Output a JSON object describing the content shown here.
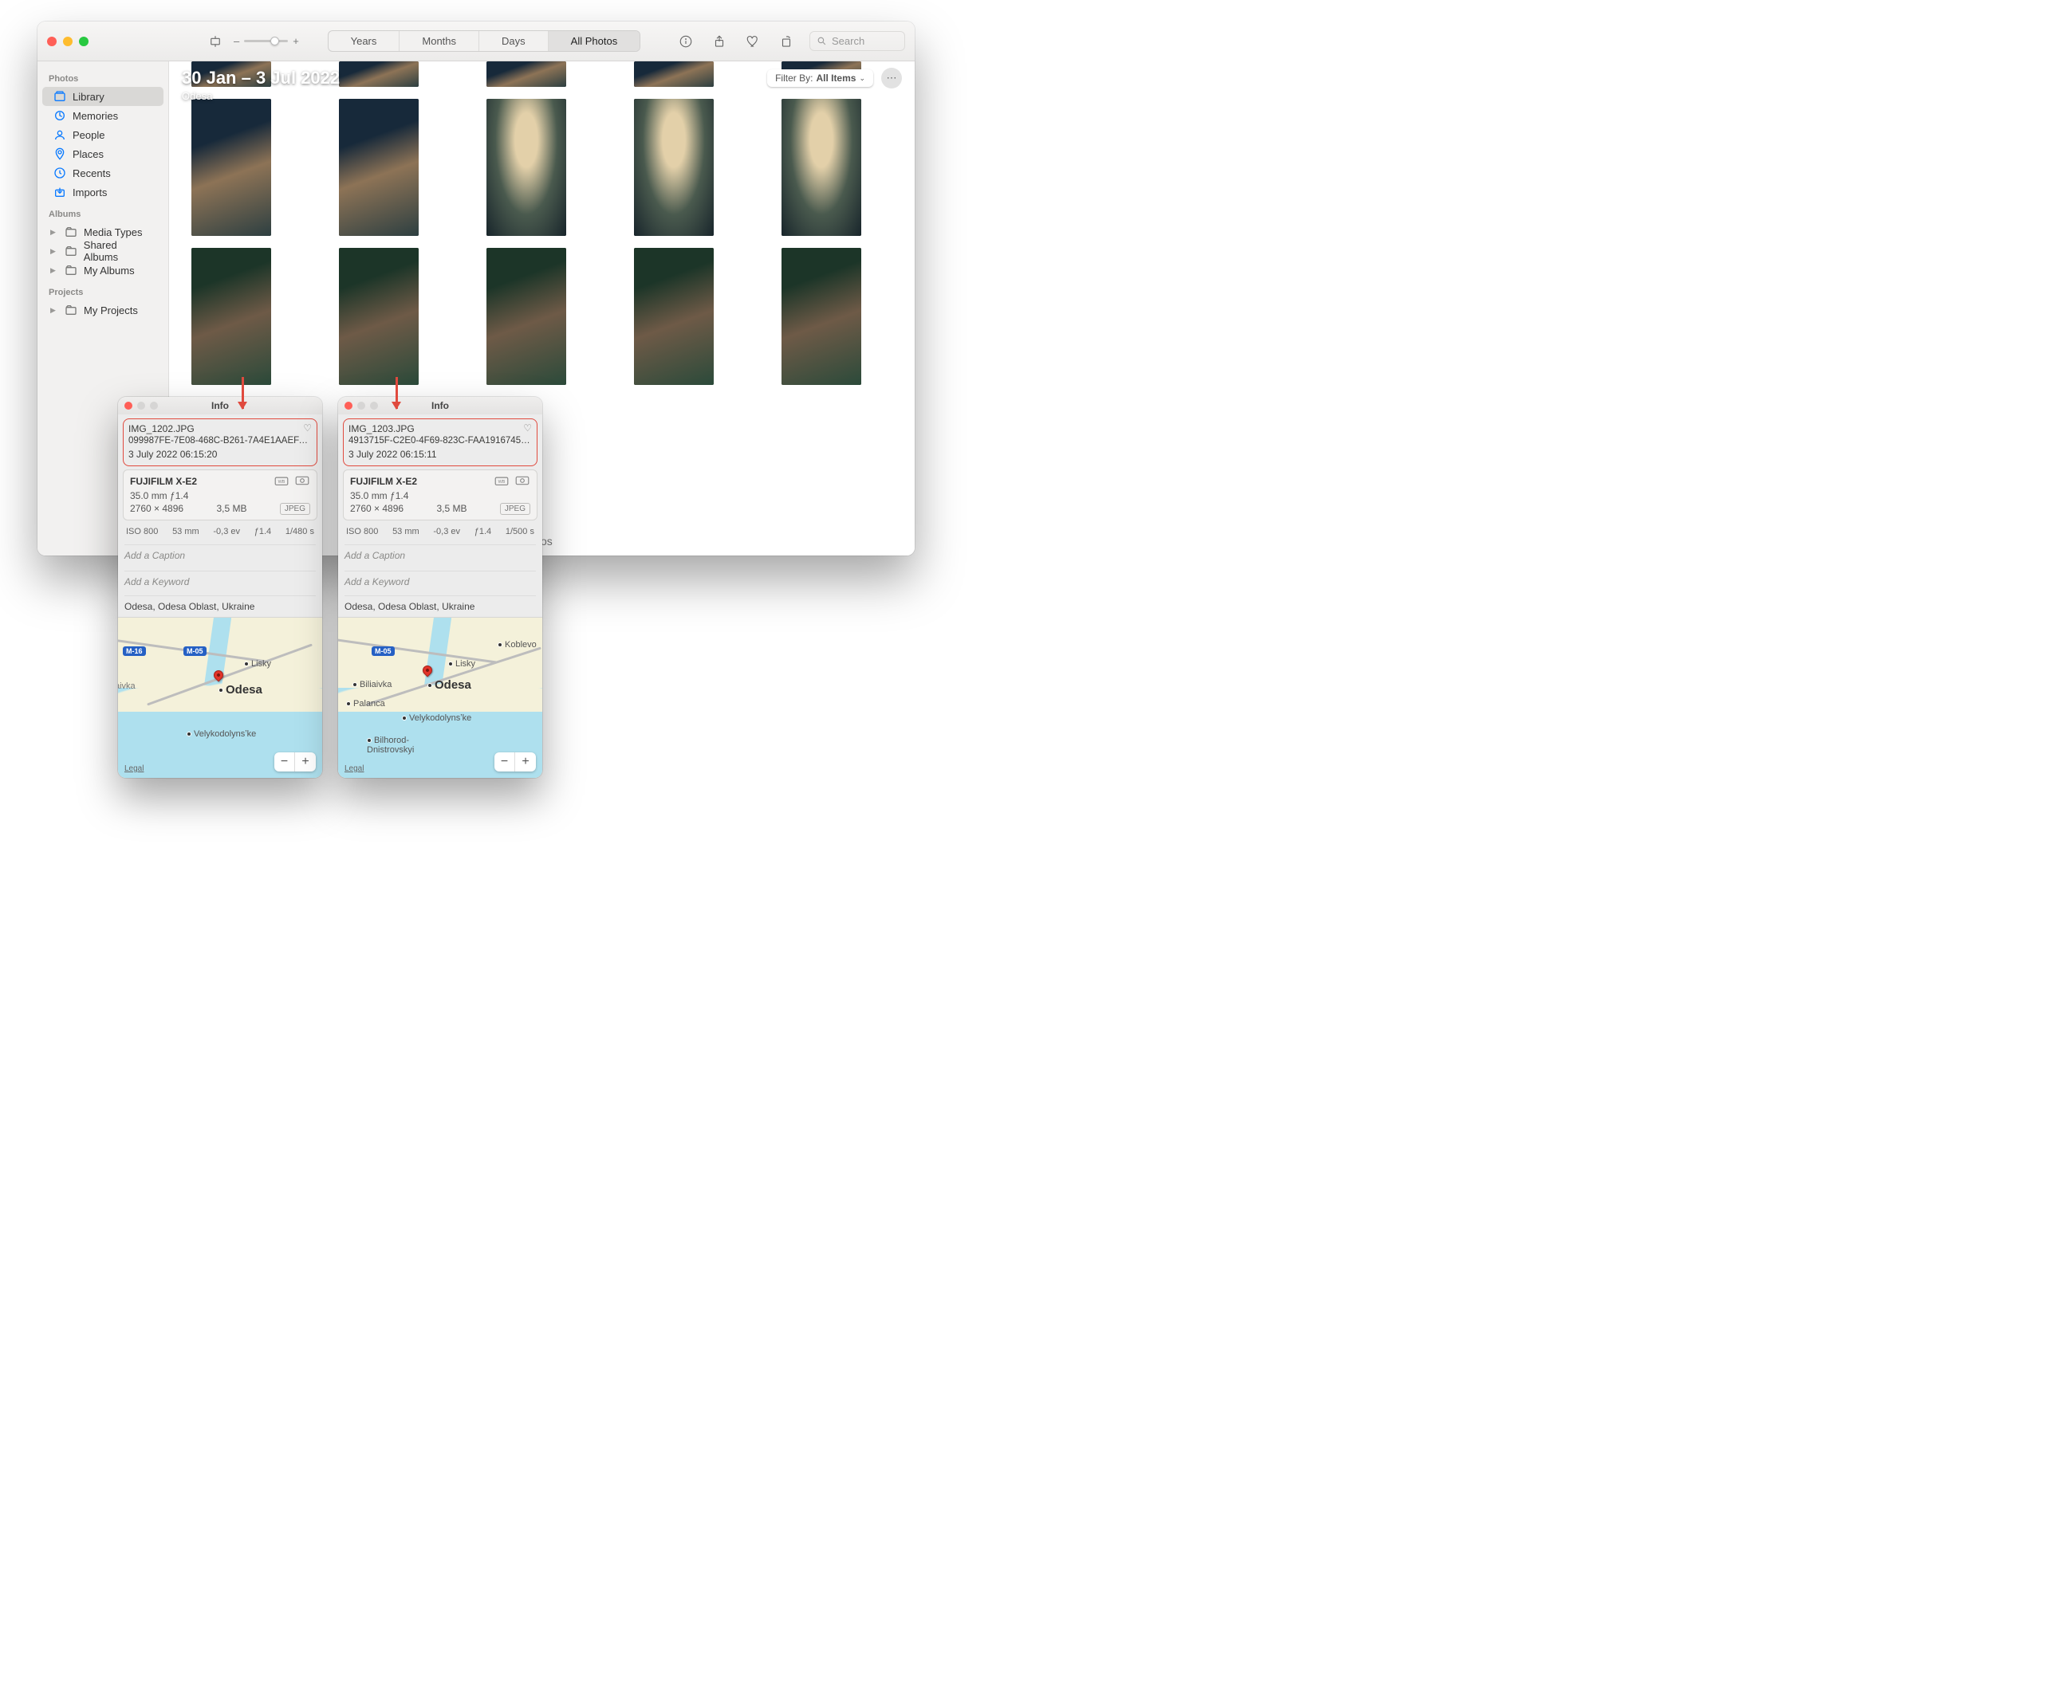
{
  "sidebar": {
    "sections": {
      "photos": {
        "title": "Photos",
        "items": [
          "Library",
          "Memories",
          "People",
          "Places",
          "Recents",
          "Imports"
        ]
      },
      "albums": {
        "title": "Albums",
        "items": [
          "Media Types",
          "Shared Albums",
          "My Albums"
        ]
      },
      "projects": {
        "title": "Projects",
        "items": [
          "My Projects"
        ]
      }
    }
  },
  "toolbar": {
    "segments": [
      "Years",
      "Months",
      "Days",
      "All Photos"
    ],
    "search_placeholder": "Search"
  },
  "header": {
    "date_range": "30 Jan – 3 Jul 2022",
    "subtitle": "Odesa",
    "filter_prefix": "Filter By:",
    "filter_value": "All Items"
  },
  "footer_fragment": "otos",
  "info_common": {
    "title": "Info",
    "caption_placeholder": "Add a Caption",
    "keyword_placeholder": "Add a Keyword",
    "legal": "Legal",
    "camera": "FUJIFILM X-E2",
    "lens": "35.0 mm ƒ1.4",
    "dimensions": "2760 × 4896",
    "filesize": "3,5 MB",
    "format_badge": "JPEG",
    "iso": "ISO 800",
    "focal": "53 mm",
    "ev": "-0,3 ev",
    "aperture": "ƒ1.4",
    "location": "Odesa, Odesa Oblast, Ukraine",
    "map_labels": {
      "city": "Odesa",
      "lisky": "Lisky",
      "biliaivka": "Biliaivka",
      "velykodolynske": "Velykodolynsʼke",
      "palanca": "Palanca",
      "bilhorod": "Bilhorod-\nDnistrovskyi",
      "koblevo": "Koblevo",
      "aivka": "aivka",
      "shield1": "M-16",
      "shield2": "M-05"
    }
  },
  "panels": {
    "left": {
      "filename": "IMG_1202.JPG",
      "uuid": "099987FE-7E08-468C-B261-7A4E1AAEFA…",
      "datetime": "3 July 2022   06:15:20",
      "shutter": "1/480 s"
    },
    "right": {
      "filename": "IMG_1203.JPG",
      "uuid": "4913715F-C2E0-4F69-823C-FAA1916745B…",
      "datetime": "3 July 2022   06:15:11",
      "shutter": "1/500 s"
    }
  }
}
